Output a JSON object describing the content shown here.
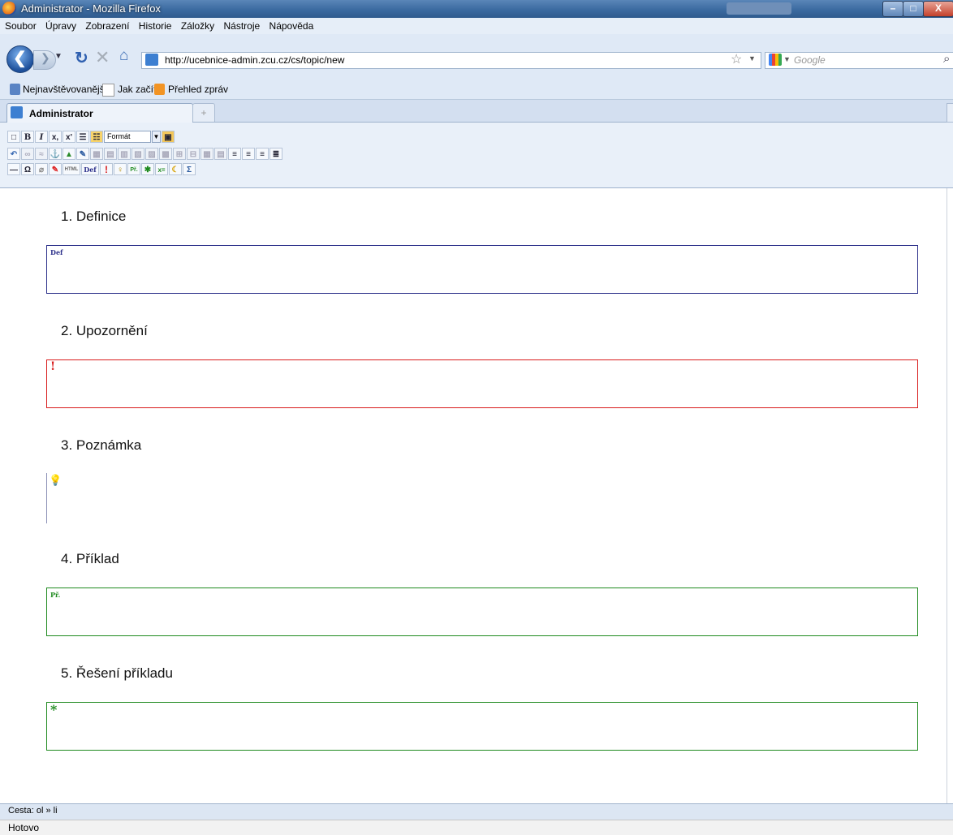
{
  "window": {
    "title": "Administrator - Mozilla Firefox",
    "controls": {
      "minimize": "–",
      "maximize": "□",
      "close": "X"
    }
  },
  "menu": [
    "Soubor",
    "Úpravy",
    "Zobrazení",
    "Historie",
    "Záložky",
    "Nástroje",
    "Nápověda"
  ],
  "nav": {
    "url": "http://ucebnice-admin.zcu.cz/cs/topic/new",
    "search_placeholder": "Google"
  },
  "bookmarks": [
    "Nejnavštěvovanější",
    "Jak začít",
    "Přehled zpráv"
  ],
  "tabs": [
    {
      "label": "Administrator",
      "active": true
    }
  ],
  "new_tab_symbol": "+",
  "editor": {
    "format_label": "Formát"
  },
  "sections": [
    {
      "heading": "1. Definice",
      "tag": "Def",
      "color": "#2b2f8a"
    },
    {
      "heading": "2. Upozornění",
      "tag": "!",
      "color": "#d81b1b"
    },
    {
      "heading": "3. Poznámka",
      "tag": "💡",
      "color": "#b58a00"
    },
    {
      "heading": "4. Příklad",
      "tag": "Př.",
      "color": "#1e8a1e"
    },
    {
      "heading": "5. Řešení příkladu",
      "tag": "*",
      "color": "#1e8a1e"
    }
  ],
  "path": "Cesta: ol » li",
  "status": "Hotovo"
}
